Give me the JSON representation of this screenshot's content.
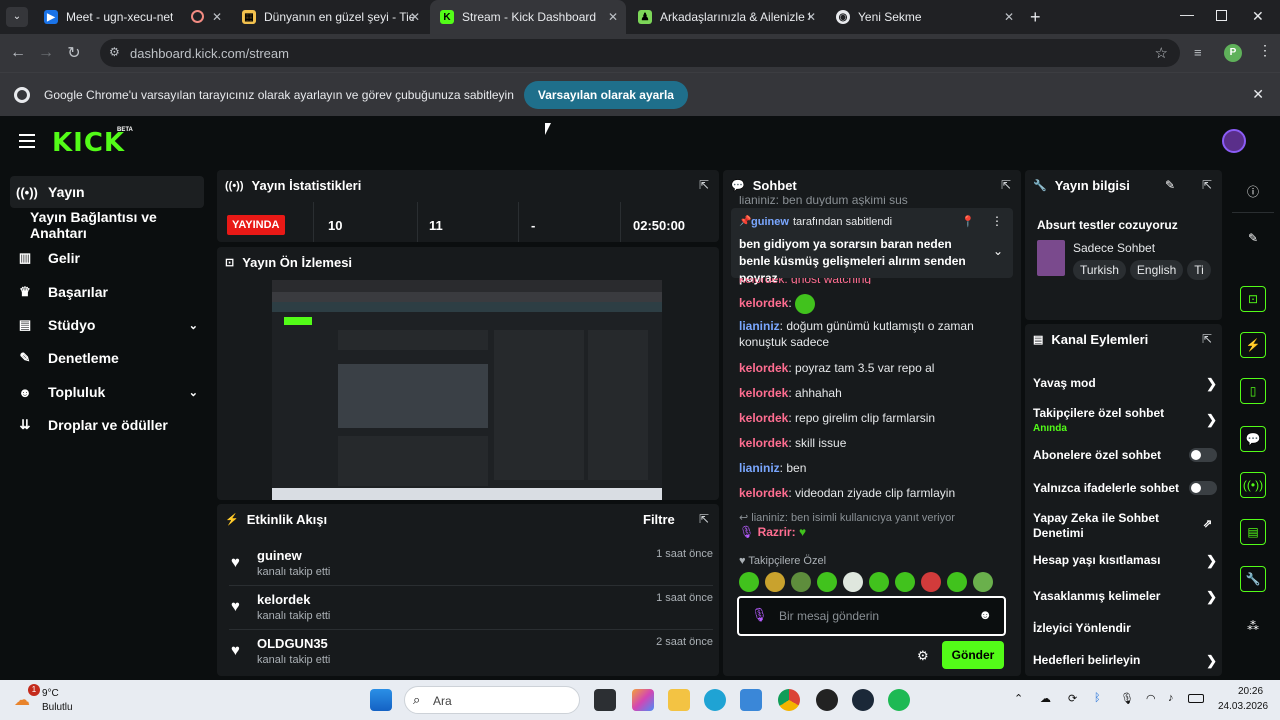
{
  "browser": {
    "tabs": [
      {
        "title": "Meet - ugn-xecu-net",
        "icon": "meet-icon",
        "color": "#1a73e8"
      },
      {
        "title": "Dünyanın en güzel şeyi - Tier Lis",
        "icon": "tierlist-icon",
        "color": "#f2c14e"
      },
      {
        "title": "Stream - Kick Dashboard",
        "icon": "kick-icon",
        "color": "#53fc18"
      },
      {
        "title": "Arkadaşlarınızla & Ailenizle Ücr",
        "icon": "person-icon",
        "color": "#7cd658"
      },
      {
        "title": "Yeni Sekme",
        "icon": "chrome-icon",
        "color": "#e8eaed"
      }
    ],
    "url": "dashboard.kick.com/stream",
    "profile_initial": "P",
    "infobar_text": "Google Chrome'u varsayılan tarayıcınız olarak ayarlayın ve görev çubuğunuza sabitleyin",
    "infobar_button": "Varsayılan olarak ayarla"
  },
  "kick": {
    "logo": "KICK",
    "beta": "BETA",
    "accent": "#53fc18"
  },
  "sidebar": {
    "items": [
      {
        "label": "Yayın",
        "icon": "broadcast-icon"
      },
      {
        "label": "Yayın Bağlantısı ve Anahtarı",
        "icon": ""
      },
      {
        "label": "Gelir",
        "icon": "chart-icon"
      },
      {
        "label": "Başarılar",
        "icon": "trophy-icon"
      },
      {
        "label": "Stüdyo",
        "icon": "studio-icon"
      },
      {
        "label": "Denetleme",
        "icon": "wrench-icon"
      },
      {
        "label": "Topluluk",
        "icon": "people-icon"
      },
      {
        "label": "Droplar ve ödüller",
        "icon": "drops-icon"
      }
    ]
  },
  "stats": {
    "title": "Yayın İstatistikleri",
    "live": "YAYINDA",
    "viewers": "10",
    "followers": "11",
    "dash": "-",
    "duration": "02:50:00"
  },
  "preview": {
    "title": "Yayın Ön İzlemesi"
  },
  "activity": {
    "title": "Etkinlik Akışı",
    "filter": "Filtre",
    "items": [
      {
        "name": "guinew",
        "desc": "kanalı takip etti",
        "time": "1 saat önce"
      },
      {
        "name": "kelordek",
        "desc": "kanalı takip etti",
        "time": "1 saat önce"
      },
      {
        "name": "OLDGUN35",
        "desc": "kanalı takip etti",
        "time": "2 saat önce"
      }
    ]
  },
  "chat": {
    "title": "Sohbet",
    "top_partial": "lianiniz: ben duydum aşkimi sus",
    "pinned_by_user": "guinew",
    "pinned_by_text": "tarafından sabitlendi",
    "pinned_message": "ben gidiyom ya sorarsın baran neden benle küsmüş gelişmeleri alırım senden poyraz",
    "partial_under_pin": "kelordek: ghost watching",
    "messages": [
      {
        "user": "kelordek",
        "cls": "u1",
        "text": ""
      },
      {
        "user": "lianiniz",
        "cls": "u2",
        "text": "doğum günümü kutlamıştı o zaman konuştuk sadece"
      },
      {
        "user": "kelordek",
        "cls": "u1",
        "text": "poyraz tam 3.5 var repo al"
      },
      {
        "user": "kelordek",
        "cls": "u1",
        "text": "ahhahah"
      },
      {
        "user": "kelordek",
        "cls": "u1",
        "text": "repo girelim clip farmlarsin"
      },
      {
        "user": "kelordek",
        "cls": "u1",
        "text": "skill issue"
      },
      {
        "user": "lianiniz",
        "cls": "u2",
        "text": "ben"
      },
      {
        "user": "kelordek",
        "cls": "u1",
        "text": "videodan ziyade clip farmlayin"
      }
    ],
    "reply_ref": "lianiniz: ben isimli kullanıcıya yanıt veriyor",
    "reply_user": "Razrir:",
    "emote_section": "Takipçilere Özel",
    "input_placeholder": "Bir mesaj gönderin",
    "send": "Gönder"
  },
  "stream_info": {
    "title": "Yayın bilgisi",
    "stream_title": "Absurt testler cozuyoruz",
    "category": "Sadece Sohbet",
    "tags": [
      "Turkish",
      "English",
      "Ti"
    ]
  },
  "channel_actions": {
    "title": "Kanal Eylemleri",
    "items": [
      {
        "label": "Yavaş mod",
        "control": "arrow",
        "sub": ""
      },
      {
        "label": "Takipçilere özel sohbet",
        "control": "arrow",
        "sub": "Anında"
      },
      {
        "label": "Abonelere özel sohbet",
        "control": "toggle",
        "sub": ""
      },
      {
        "label": "Yalnızca ifadelerle sohbet",
        "control": "toggle",
        "sub": ""
      },
      {
        "label": "Yapay Zeka ile Sohbet Denetimi",
        "control": "external",
        "sub": ""
      },
      {
        "label": "Hesap yaşı kısıtlaması",
        "control": "arrow",
        "sub": ""
      },
      {
        "label": "Yasaklanmış kelimeler",
        "control": "arrow",
        "sub": ""
      },
      {
        "label": "İzleyici Yönlendir",
        "control": "none",
        "sub": ""
      },
      {
        "label": "Hedefleri belirleyin",
        "control": "arrow",
        "sub": ""
      }
    ]
  },
  "taskbar": {
    "weather_temp": "9°C",
    "weather_desc": "Bulutlu",
    "notif_count": "1",
    "search": "Ara",
    "time": "20:26",
    "date": "24.03.2026"
  }
}
